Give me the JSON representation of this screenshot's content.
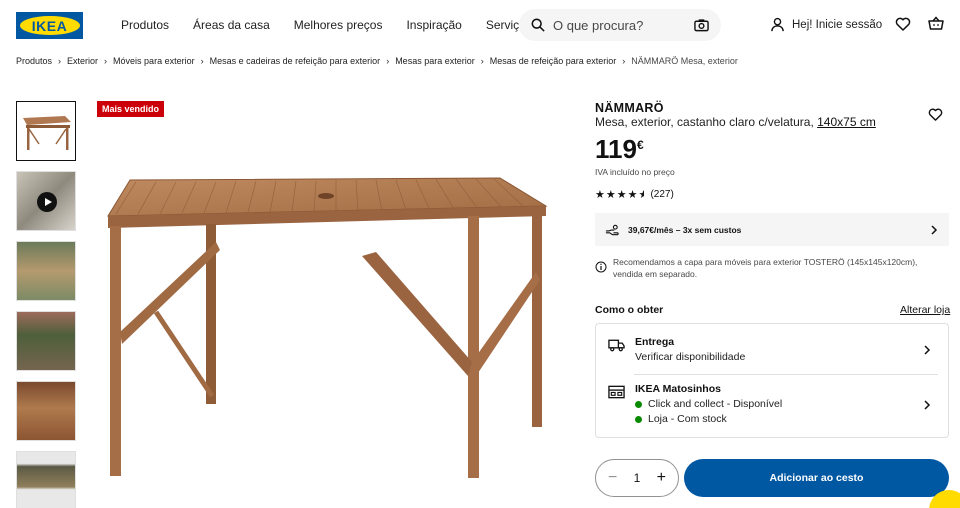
{
  "header": {
    "logo_text": "IKEA",
    "nav": [
      "Produtos",
      "Áreas da casa",
      "Melhores preços",
      "Inspiração",
      "Serviços"
    ],
    "search_placeholder": "O que procura?",
    "login_label": "Hej! Inicie sessão"
  },
  "breadcrumb": [
    "Produtos",
    "Exterior",
    "Móveis para exterior",
    "Mesas e cadeiras de refeição para exterior",
    "Mesas para exterior",
    "Mesas de refeição para exterior",
    "NÄMMARÖ Mesa, exterior"
  ],
  "gallery": {
    "badge": "Mais vendido"
  },
  "product": {
    "name": "NÄMMARÖ",
    "description": "Mesa, exterior, castanho claro c/velatura,",
    "size_link": "140x75 cm",
    "price": "119",
    "currency": "€",
    "vat_note": "IVA incluído no preço",
    "rating": 4.5,
    "rating_count": "(227)",
    "installment": "39,67€/mês – 3x sem custos",
    "notice": "Recomendamos a capa para móveis para exterior TOSTERÖ (145x145x120cm), vendida em separado."
  },
  "fulfillment": {
    "heading": "Como o obter",
    "change_store": "Alterar loja",
    "delivery_title": "Entrega",
    "delivery_sub": "Verificar disponibilidade",
    "store_title": "IKEA Matosinhos",
    "store_line1": "Click and collect - Disponível",
    "store_line2": "Loja - Com stock"
  },
  "cart": {
    "quantity": "1",
    "add_label": "Adicionar ao cesto"
  },
  "colors": {
    "brand_blue": "#0058a3",
    "brand_yellow": "#ffdb00",
    "badge_red": "#cc0008",
    "available_green": "#0a8a00"
  }
}
